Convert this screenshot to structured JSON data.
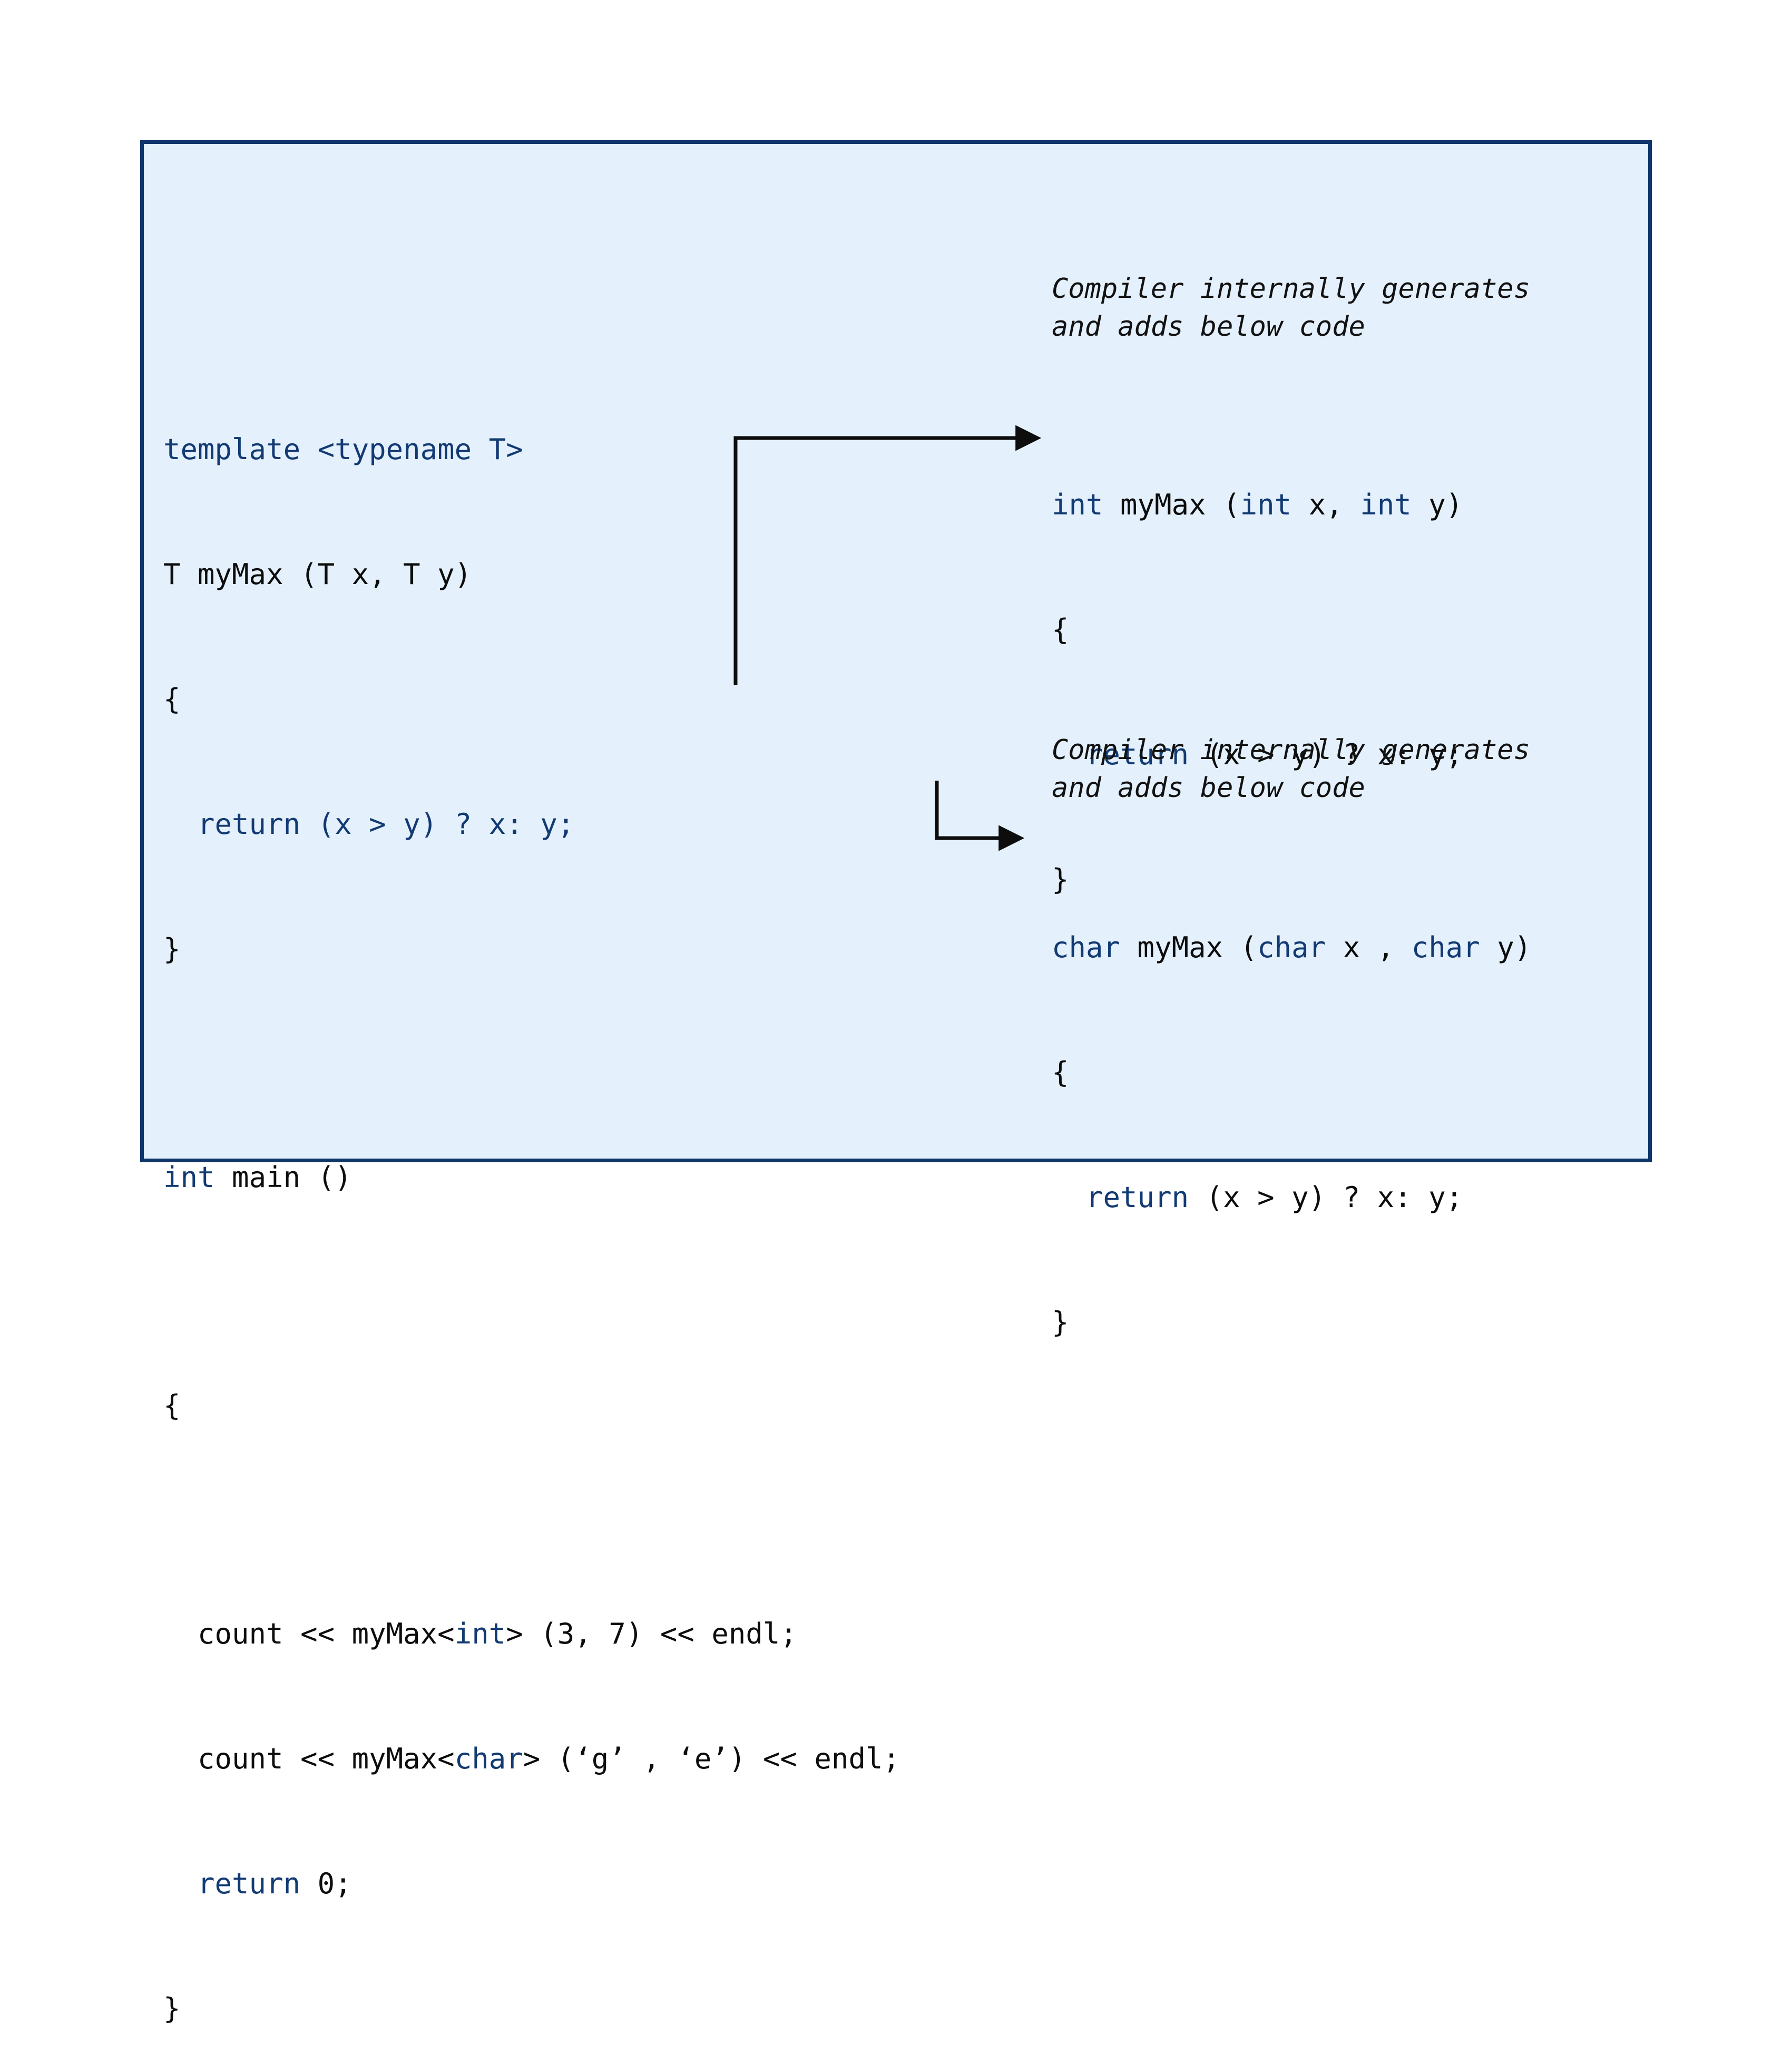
{
  "panel": {
    "background_color": "#e4f0fb",
    "border_color": "#10356b"
  },
  "colors": {
    "keyword_blue": "#123a73",
    "plain_black": "#0d0d0d",
    "arrow_black": "#0d0d0d"
  },
  "template_code": {
    "line1": "template <typename T>",
    "line2": "T myMax (T x, T y)",
    "line3": "{",
    "line4": "  return (x > y) ? x: y;",
    "line5": "}",
    "line6_kw": "int",
    "line6_rest": " main ()",
    "line7": "{",
    "line8_a": "  count << myMax<",
    "line8_kw": "int",
    "line8_b": "> (3, 7) << endl;",
    "line9_a": "  count << myMax<",
    "line9_kw": "char",
    "line9_b": "> (‘g’ , ‘e’) << endl;",
    "line10_kw": "  return",
    "line10_rest": " 0;",
    "line11": "}"
  },
  "int_instantiation": {
    "note": "Compiler internally generates\nand adds below code",
    "sig_kw1": "int",
    "sig_mid": " myMax (",
    "sig_kw2": "int",
    "sig_x": " x, ",
    "sig_kw3": "int",
    "sig_end": " y)",
    "brace_open": "{",
    "body_kw": "  return",
    "body_rest": " (x > y) ? x: y;",
    "brace_close": "}"
  },
  "char_instantiation": {
    "note": "Compiler internally generates\nand adds below code",
    "sig_kw1": "char",
    "sig_mid": " myMax (",
    "sig_kw2": "char",
    "sig_x": " x , ",
    "sig_kw3": "char",
    "sig_end": " y)",
    "brace_open": "{",
    "body_kw": "  return",
    "body_rest": " (x > y) ? x: y;",
    "brace_close": "}"
  },
  "arrows": {
    "arrow_int_label": "arrow-to-int-instantiation",
    "arrow_char_label": "arrow-to-char-instantiation"
  }
}
